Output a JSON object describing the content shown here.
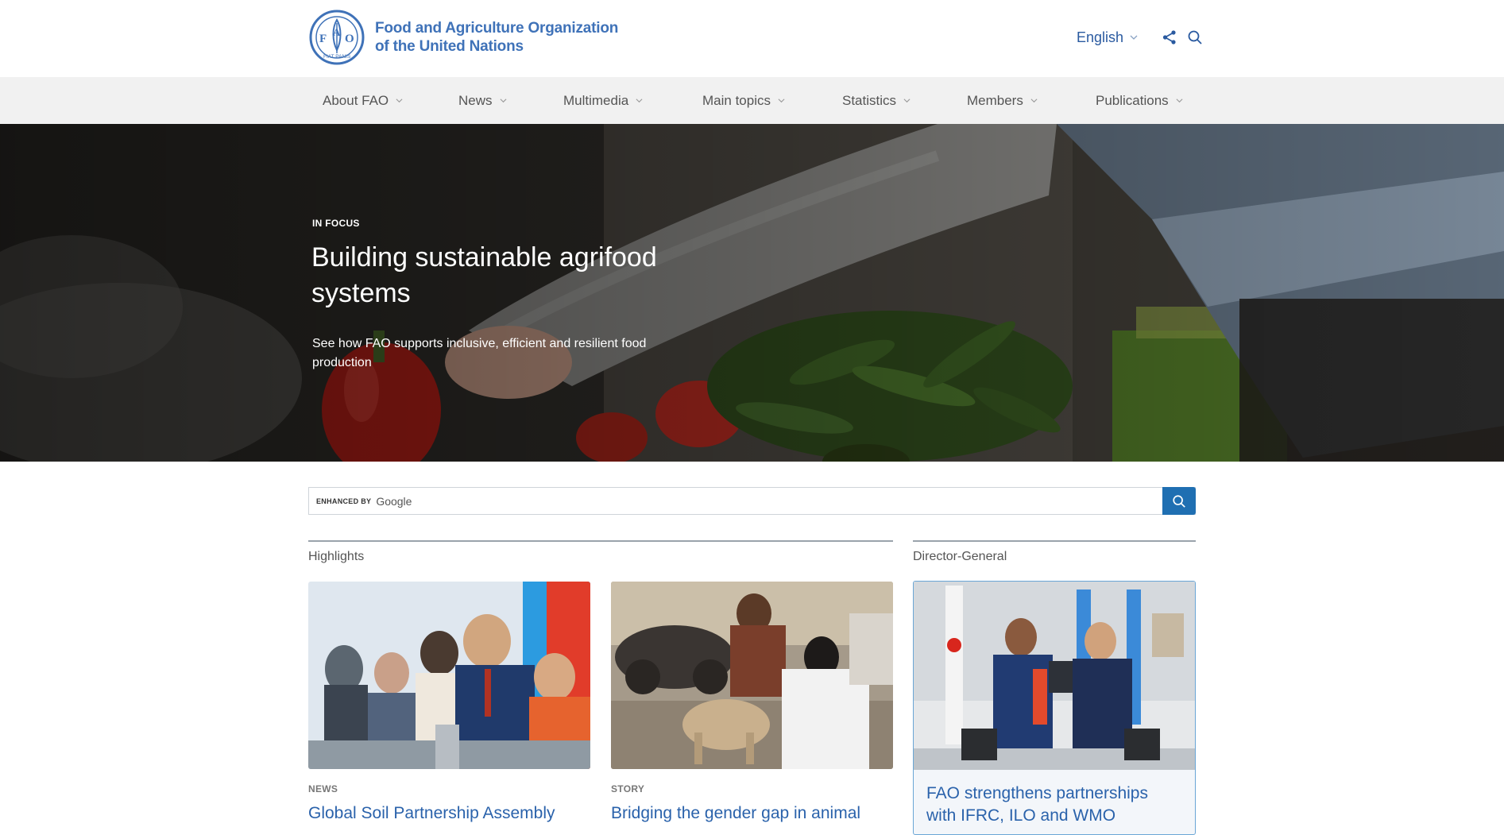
{
  "header": {
    "logo_line1": "Food and Agriculture Organization",
    "logo_line2": "of the United Nations",
    "emblem_letters": [
      "F",
      "A",
      "O"
    ],
    "emblem_motto": "FIAT PANIS",
    "language": "English",
    "brand_color": "#3f72b8"
  },
  "nav": {
    "items": [
      {
        "label": "About FAO"
      },
      {
        "label": "News"
      },
      {
        "label": "Multimedia"
      },
      {
        "label": "Main topics"
      },
      {
        "label": "Statistics"
      },
      {
        "label": "Members"
      },
      {
        "label": "Publications"
      }
    ]
  },
  "hero": {
    "kicker": "IN FOCUS",
    "title": "Building sustainable agrifood systems",
    "description": "See how FAO supports inclusive, efficient and resilient food production"
  },
  "search": {
    "enhanced_label": "ENHANCED BY",
    "provider": "Google",
    "value": "",
    "button_color": "#1f6fb2"
  },
  "highlights": {
    "heading": "Highlights",
    "cards": [
      {
        "kicker": "NEWS",
        "title": "Global Soil Partnership Assembly"
      },
      {
        "kicker": "STORY",
        "title": "Bridging the gender gap in animal"
      }
    ]
  },
  "director_general": {
    "heading": "Director-General",
    "card_title": "FAO strengthens partnerships with IFRC, ILO and WMO"
  },
  "icons": {
    "language_chevron": "chevron-down-icon",
    "share": "share-icon",
    "search": "search-icon"
  },
  "colors": {
    "link": "#2a62ab",
    "nav_bg": "#f1f1f1",
    "dg_card_border": "#6aa6d6"
  }
}
